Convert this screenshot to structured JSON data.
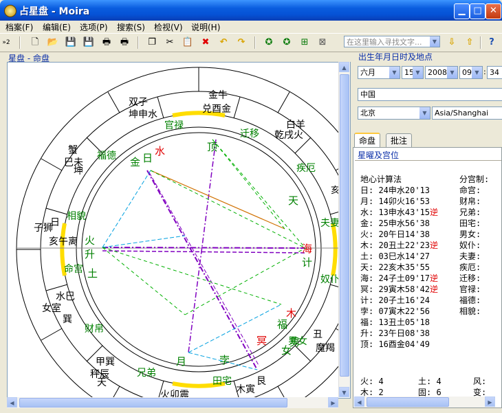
{
  "window": {
    "title": "占星盘 - Moira",
    "minimize": "▁",
    "maximize": "□",
    "close": "✕"
  },
  "menu": [
    "档案(F)",
    "编辑(E)",
    "选项(P)",
    "搜索(S)",
    "检视(V)",
    "说明(H)"
  ],
  "toolbar": {
    "search_placeholder": "在这里输入寻找文字...",
    "buttons": [
      "new-icon",
      "open-icon",
      "save-icon",
      "save-as-icon",
      "print-icon",
      "print-preview-icon",
      "copy-icon",
      "cut-icon",
      "delete-icon",
      "undo-icon",
      "redo-icon",
      "chart-icon",
      "chart2-icon",
      "chart3-icon",
      "chart4-icon",
      "download-icon",
      "upload-icon",
      "help-icon"
    ],
    "arrow_label": "»2"
  },
  "chart": {
    "header": "星盘 - 命盘",
    "outer_ring": [
      "金牛",
      "白羊",
      "兑酉金",
      "乾戌火",
      "坎子水",
      "坤申水",
      "双子",
      "蟹",
      "巳未",
      "坤",
      "子狮",
      "亥午离",
      "日",
      "水巳",
      "女室",
      "巽",
      "秤辰",
      "天",
      "甲巽",
      "火卯震",
      "木寅",
      "艮",
      "丑",
      "魔羯",
      "亥",
      "人"
    ],
    "house_labels": [
      "官禄",
      "迁移",
      "疾厄",
      "夫妻",
      "奴仆",
      "男女",
      "田宅",
      "兄弟",
      "财帛",
      "命宫",
      "相貌",
      "福德"
    ],
    "planet_labels": [
      "金",
      "日",
      "水",
      "顶",
      "天",
      "海",
      "计",
      "木",
      "福",
      "冥",
      "男",
      "女",
      "孛",
      "月",
      "火",
      "升",
      "土"
    ]
  },
  "birth": {
    "header": "出生年月日时及地点",
    "month": "六月",
    "day": "15",
    "year": "2008",
    "hour": "09",
    "minute": "34",
    "country": "中国",
    "city": "北京",
    "timezone": "Asia/Shanghai"
  },
  "tabs": [
    "命盘",
    "批注"
  ],
  "positions": {
    "header": "星曜及宫位",
    "method_label": "地心计算法",
    "house_system_label": "分宫制:",
    "rows": [
      {
        "text": "日: 24申水20'13",
        "retro": ""
      },
      {
        "text": "月: 14卯火16'53",
        "retro": ""
      },
      {
        "text": "水: 13申水43'15",
        "retro": "逆"
      },
      {
        "text": "金: 25申水56'38",
        "retro": ""
      },
      {
        "text": "火: 20午日14'38",
        "retro": ""
      },
      {
        "text": "木: 20丑土22'23",
        "retro": "逆"
      },
      {
        "text": "土: 03巳水14'27",
        "retro": ""
      },
      {
        "text": "天: 22亥木35'55",
        "retro": ""
      },
      {
        "text": "海: 24子土09'17",
        "retro": "逆"
      },
      {
        "text": "冥: 29寅木58'42",
        "retro": "逆"
      },
      {
        "text": "计: 20子土16'24",
        "retro": ""
      },
      {
        "text": "孛: 07寅木22'56",
        "retro": ""
      },
      {
        "text": "福: 13丑土05'18",
        "retro": ""
      },
      {
        "text": "升: 23午日08'38",
        "retro": ""
      },
      {
        "text": "顶: 16酉金04'49",
        "retro": ""
      }
    ],
    "houses": [
      "命宫:",
      "财帛:",
      "兄弟:",
      "田宅:",
      "男女:",
      "奴仆:",
      "夫妻:",
      "疾厄:",
      "迁移:",
      "官禄:",
      "福德:",
      "相貌:"
    ],
    "summary": [
      "火: 4",
      "土: 4",
      "风: ",
      "木: 2",
      "固: 6",
      "变: "
    ]
  },
  "colors": {
    "title_bar": "#0a5ddf",
    "accent_yellow": "#ffdd00",
    "retro_red": "#e00000",
    "house_green": "#008000"
  }
}
